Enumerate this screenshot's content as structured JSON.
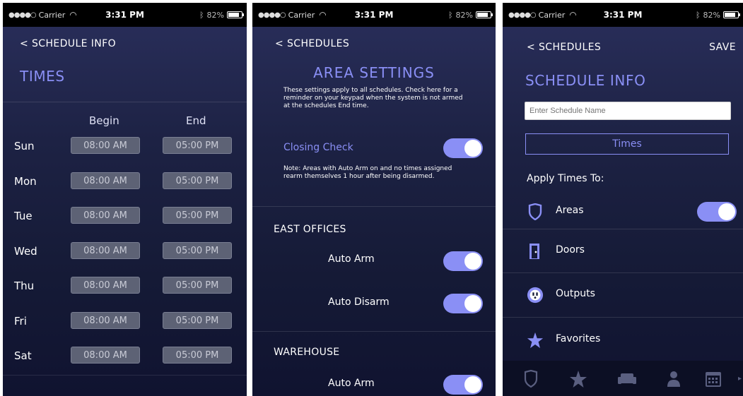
{
  "status": {
    "carrier": "Carrier",
    "time": "3:31 PM",
    "battery": "82%",
    "battery_level": 0.82
  },
  "panel1": {
    "back": "< SCHEDULE INFO",
    "title": "TIMES",
    "begin_header": "Begin",
    "end_header": "End",
    "days": [
      {
        "day": "Sun",
        "begin": "08:00 AM",
        "end": "05:00 PM"
      },
      {
        "day": "Mon",
        "begin": "08:00 AM",
        "end": "05:00 PM"
      },
      {
        "day": "Tue",
        "begin": "08:00 AM",
        "end": "05:00 PM"
      },
      {
        "day": "Wed",
        "begin": "08:00 AM",
        "end": "05:00 PM"
      },
      {
        "day": "Thu",
        "begin": "08:00 AM",
        "end": "05:00 PM"
      },
      {
        "day": "Fri",
        "begin": "08:00 AM",
        "end": "05:00 PM"
      },
      {
        "day": "Sat",
        "begin": "08:00 AM",
        "end": "05:00 PM"
      }
    ]
  },
  "panel2": {
    "back": "< SCHEDULES",
    "title": "AREA SETTINGS",
    "description": "These settings apply to all schedules. Check here for a reminder on your keypad when the system is not armed at the schedules End time.",
    "closing_check": "Closing Check",
    "note": "Note: Areas with Auto Arm on and no times assigned rearm themselves 1 hour after being disarmed.",
    "east_offices": "EAST OFFICES",
    "auto_arm": "Auto Arm",
    "auto_disarm": "Auto Disarm",
    "warehouse": "WAREHOUSE",
    "warehouse_auto_arm": "Auto Arm"
  },
  "panel3": {
    "back": "< SCHEDULES",
    "save": "SAVE",
    "title": "SCHEDULE INFO",
    "name_placeholder": "Enter Schedule Name",
    "times": "Times",
    "apply_label": "Apply Times To:",
    "areas": "Areas",
    "doors": "Doors",
    "outputs": "Outputs",
    "favorites": "Favorites"
  },
  "icons": {
    "areas": "shield-icon",
    "doors": "door-icon",
    "outputs": "outlet-icon",
    "favorites": "star-icon",
    "tabs": [
      "shield-icon",
      "star-icon",
      "sofa-icon",
      "user-icon",
      "calendar-icon"
    ]
  },
  "colors": {
    "accent": "#8a8ff5",
    "background": "#1d2244"
  }
}
